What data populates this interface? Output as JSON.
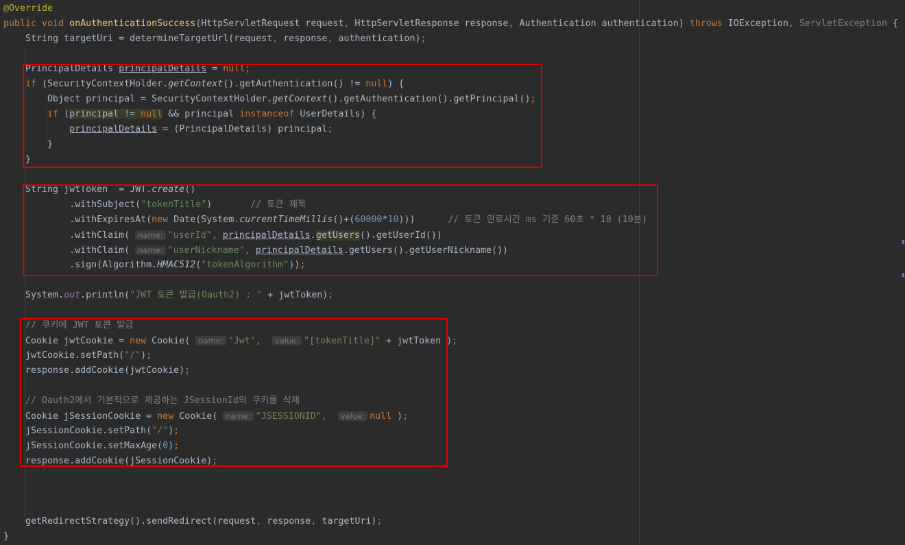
{
  "editor": {
    "lines": [
      {
        "tokens": [
          {
            "t": "@Override",
            "c": "ann"
          }
        ]
      },
      {
        "tokens": [
          {
            "t": "public void ",
            "c": "kw"
          },
          {
            "t": "onAuthenticationSuccess",
            "c": "fn"
          },
          {
            "t": "(HttpServletRequest request"
          },
          {
            "t": ", ",
            "c": "kw"
          },
          {
            "t": "HttpServletResponse response"
          },
          {
            "t": ", ",
            "c": "kw"
          },
          {
            "t": "Authentication authentication) "
          },
          {
            "t": "throws ",
            "c": "kw"
          },
          {
            "t": "IOException"
          },
          {
            "t": ", ",
            "c": "kw"
          },
          {
            "t": "ServletException",
            "c": "dim"
          },
          {
            "t": " {"
          }
        ]
      },
      {
        "tokens": [
          {
            "t": "    String targetUri = determineTargetUrl(request"
          },
          {
            "t": ", ",
            "c": "kw"
          },
          {
            "t": "response"
          },
          {
            "t": ", ",
            "c": "kw"
          },
          {
            "t": "authentication)"
          },
          {
            "t": ";",
            "c": "kw"
          }
        ]
      },
      {
        "tokens": []
      },
      {
        "tokens": [
          {
            "t": "    PrincipalDetails "
          },
          {
            "t": "principalDetails",
            "c": "u"
          },
          {
            "t": " = "
          },
          {
            "t": "null;",
            "c": "kw"
          }
        ]
      },
      {
        "tokens": [
          {
            "t": "    "
          },
          {
            "t": "if ",
            "c": "kw"
          },
          {
            "t": "(SecurityContextHolder."
          },
          {
            "t": "getContext",
            "c": "italic"
          },
          {
            "t": "().getAuthentication() != "
          },
          {
            "t": "null",
            "c": "kw"
          },
          {
            "t": ") {"
          }
        ]
      },
      {
        "tokens": [
          {
            "t": "        Object principal = SecurityContextHolder."
          },
          {
            "t": "getContext",
            "c": "italic"
          },
          {
            "t": "().getAuthentication().getPrincipal()"
          },
          {
            "t": ";",
            "c": "kw"
          }
        ]
      },
      {
        "tokens": [
          {
            "t": "        "
          },
          {
            "t": "if ",
            "c": "kw"
          },
          {
            "t": "(",
            "c": ""
          },
          {
            "t": "principal != ",
            "c": "hl"
          },
          {
            "t": "null",
            "c": "kwhl"
          },
          {
            "t": " && principal "
          },
          {
            "t": "instanceof ",
            "c": "kw"
          },
          {
            "t": "UserDetails) {"
          }
        ]
      },
      {
        "tokens": [
          {
            "t": "            "
          },
          {
            "t": "principalDetails",
            "c": "u"
          },
          {
            "t": " = (PrincipalDetails) principal"
          },
          {
            "t": ";",
            "c": "kw"
          }
        ]
      },
      {
        "tokens": [
          {
            "t": "        }"
          }
        ]
      },
      {
        "tokens": [
          {
            "t": "    }"
          }
        ]
      },
      {
        "tokens": []
      },
      {
        "tokens": [
          {
            "t": "    String jwtToken  = JWT."
          },
          {
            "t": "create",
            "c": "italic"
          },
          {
            "t": "()"
          }
        ]
      },
      {
        "tokens": [
          {
            "t": "            .withSubject("
          },
          {
            "t": "\"tokenTitle\"",
            "c": "str"
          },
          {
            "t": ")       "
          },
          {
            "t": "// 토큰 제목",
            "c": "cmt"
          }
        ]
      },
      {
        "tokens": [
          {
            "t": "            .withExpiresAt("
          },
          {
            "t": "new ",
            "c": "kw"
          },
          {
            "t": "Date(System."
          },
          {
            "t": "currentTimeMillis",
            "c": "italic"
          },
          {
            "t": "()+("
          },
          {
            "t": "60000",
            "c": "num"
          },
          {
            "t": "*"
          },
          {
            "t": "10",
            "c": "num"
          },
          {
            "t": ")))      "
          },
          {
            "t": "// 토큰 만료시간 ms 기준 60초 * 10 (10분)",
            "c": "cmt"
          }
        ]
      },
      {
        "tokens": [
          {
            "t": "            .withClaim( "
          },
          {
            "t": "name:",
            "c": "hint"
          },
          {
            "t": "\"userId\"",
            "c": "str"
          },
          {
            "t": ", ",
            "c": "kw"
          },
          {
            "t": "principalDetails",
            "c": "u"
          },
          {
            "t": "."
          },
          {
            "t": "getUsers",
            "c": "hl"
          },
          {
            "t": "().getUserId())"
          }
        ]
      },
      {
        "tokens": [
          {
            "t": "            .withClaim( "
          },
          {
            "t": "name:",
            "c": "hint"
          },
          {
            "t": "\"userNickname\"",
            "c": "str"
          },
          {
            "t": ", ",
            "c": "kw"
          },
          {
            "t": "principalDetails",
            "c": "u"
          },
          {
            "t": ".getUsers().getUserNickname())"
          }
        ]
      },
      {
        "tokens": [
          {
            "t": "            .sign(Algorithm."
          },
          {
            "t": "HMAC512",
            "c": "italic"
          },
          {
            "t": "("
          },
          {
            "t": "\"tokenAlgorithm\"",
            "c": "str"
          },
          {
            "t": "))"
          },
          {
            "t": ";",
            "c": "kw"
          }
        ]
      },
      {
        "tokens": []
      },
      {
        "tokens": [
          {
            "t": "    System."
          },
          {
            "t": "out",
            "c": "static"
          },
          {
            "t": ".println("
          },
          {
            "t": "\"JWT 토큰 발급(Oauth2) : \"",
            "c": "str"
          },
          {
            "t": " + jwtToken)"
          },
          {
            "t": ";",
            "c": "kw"
          }
        ]
      },
      {
        "tokens": []
      },
      {
        "tokens": [
          {
            "t": "    // 쿠키에 JWT 토큰 발급",
            "c": "cmt"
          }
        ]
      },
      {
        "tokens": [
          {
            "t": "    Cookie jwtCookie = "
          },
          {
            "t": "new ",
            "c": "kw"
          },
          {
            "t": "Cookie( "
          },
          {
            "t": "name:",
            "c": "hint"
          },
          {
            "t": "\"Jwt\"",
            "c": "str"
          },
          {
            "t": ",  ",
            "c": "kw"
          },
          {
            "t": "value:",
            "c": "hint"
          },
          {
            "t": "\"[tokenTitle]\"",
            "c": "str"
          },
          {
            "t": " + jwtToken )"
          },
          {
            "t": ";",
            "c": "kw"
          }
        ]
      },
      {
        "tokens": [
          {
            "t": "    jwtCookie.setPath("
          },
          {
            "t": "\"/\"",
            "c": "str"
          },
          {
            "t": ")"
          },
          {
            "t": ";",
            "c": "kw"
          }
        ]
      },
      {
        "tokens": [
          {
            "t": "    response.addCookie(jwtCookie)"
          },
          {
            "t": ";",
            "c": "kw"
          }
        ]
      },
      {
        "tokens": []
      },
      {
        "tokens": [
          {
            "t": "    // Oauth2에서 기본적으로 제공하는 JSessionId의 쿠키를 삭제",
            "c": "cmt"
          }
        ]
      },
      {
        "tokens": [
          {
            "t": "    Cookie jSessionCookie = "
          },
          {
            "t": "new ",
            "c": "kw"
          },
          {
            "t": "Cookie( "
          },
          {
            "t": "name:",
            "c": "hint"
          },
          {
            "t": "\"JSESSIONID\"",
            "c": "str"
          },
          {
            "t": ",  ",
            "c": "kw"
          },
          {
            "t": "value:",
            "c": "hint"
          },
          {
            "t": "null ",
            "c": "kw"
          },
          {
            "t": ")"
          },
          {
            "t": ";",
            "c": "kw"
          }
        ]
      },
      {
        "tokens": [
          {
            "t": "    jSessionCookie.setPath("
          },
          {
            "t": "\"/\"",
            "c": "str"
          },
          {
            "t": ")"
          },
          {
            "t": ";",
            "c": "kw"
          }
        ]
      },
      {
        "tokens": [
          {
            "t": "    jSessionCookie.setMaxAge("
          },
          {
            "t": "0",
            "c": "num"
          },
          {
            "t": ")"
          },
          {
            "t": ";",
            "c": "kw"
          }
        ]
      },
      {
        "tokens": [
          {
            "t": "    response.addCookie(jSessionCookie)"
          },
          {
            "t": ";",
            "c": "kw"
          }
        ]
      },
      {
        "tokens": []
      },
      {
        "tokens": []
      },
      {
        "tokens": []
      },
      {
        "tokens": [
          {
            "t": "    getRedirectStrategy().sendRedirect(request"
          },
          {
            "t": ", ",
            "c": "kw"
          },
          {
            "t": "response"
          },
          {
            "t": ", ",
            "c": "kw"
          },
          {
            "t": "targetUri)"
          },
          {
            "t": ";",
            "c": "kw"
          }
        ]
      },
      {
        "tokens": [
          {
            "t": "}"
          }
        ]
      }
    ]
  },
  "colors": {
    "background": "#2b2b2b",
    "keyword": "#cc7832",
    "annotation": "#bbb529",
    "method_declaration": "#ffc66d",
    "string": "#6a8759",
    "number": "#6897bb",
    "comment": "#808080",
    "highlight_box": "#e00000"
  }
}
